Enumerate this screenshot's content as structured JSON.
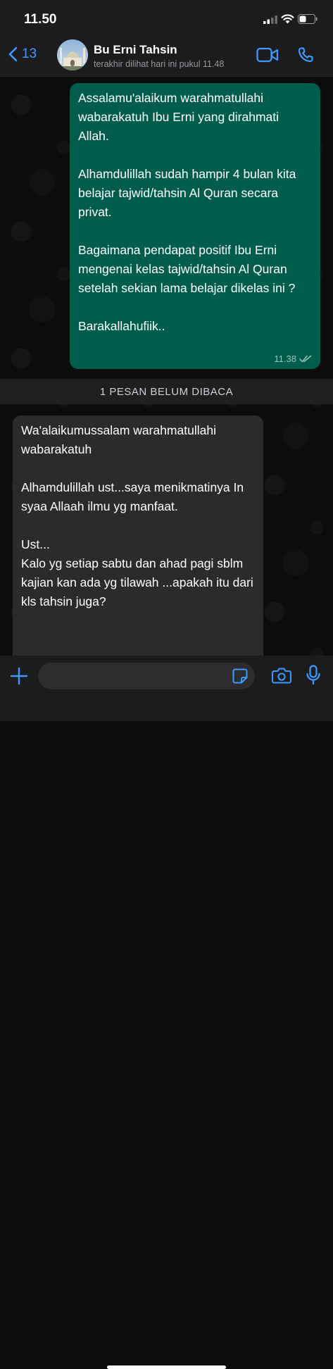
{
  "status_bar": {
    "time": "11.50"
  },
  "header": {
    "back_count": "13",
    "contact_name": "Bu Erni Tahsin",
    "last_seen": "terakhir dilihat hari ini pukul 11.48"
  },
  "messages": {
    "outgoing": {
      "paragraphs": [
        "Assalamu'alaikum warahmatullahi wabarakatuh Ibu Erni yang dirahmati Allah.",
        "Alhamdulillah sudah hampir 4 bulan kita belajar tajwid/tahsin Al Quran secara privat.",
        "Bagaimana pendapat positif Ibu Erni mengenai kelas tajwid/tahsin Al Quran setelah sekian lama belajar dikelas ini ?",
        "Barakallahufiik.."
      ],
      "time": "11.38",
      "status": "read"
    },
    "unread_divider": "1 PESAN BELUM DIBACA",
    "incoming": {
      "paragraphs": [
        "Wa'alaikumussalam warahmatullahi wabarakatuh",
        "Alhamdulillah ust...saya menikmatinya In syaa Allaah ilmu yg manfaat.",
        "Ust...\nKalo yg setiap sabtu dan ahad pagi sblm kajian kan ada yg tilawah ...apakah itu dari kls tahsin juga?"
      ]
    }
  },
  "composer": {
    "input_value": "",
    "placeholder": ""
  },
  "colors": {
    "accent": "#3b9bff",
    "outgoing_bubble": "#005c4b",
    "incoming_bubble": "#2b2b2d",
    "bar_background": "#1c1c1e"
  },
  "icons": [
    "chevron-left-icon",
    "video-call-icon",
    "phone-icon",
    "double-check-icon",
    "plus-icon",
    "sticker-icon",
    "camera-icon",
    "microphone-icon"
  ]
}
